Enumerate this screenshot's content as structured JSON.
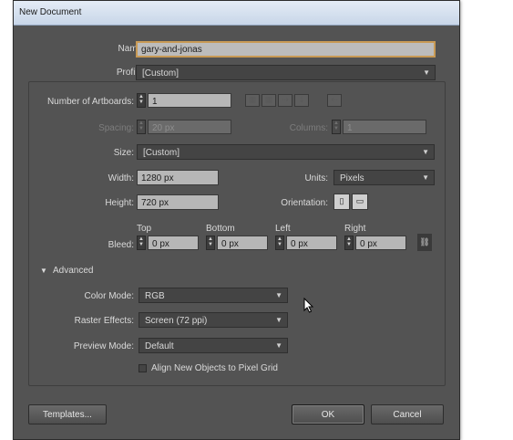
{
  "window": {
    "title": "New Document"
  },
  "name": {
    "label": "Name:",
    "value": "gary-and-jonas"
  },
  "profile": {
    "label": "Profile:",
    "value": "[Custom]"
  },
  "artboards": {
    "label": "Number of Artboards:",
    "value": "1",
    "arrange_icons": [
      "grid-by-row-icon",
      "grid-by-column-icon",
      "arrange-by-row-icon",
      "arrange-by-column-icon",
      "right-to-left-icon"
    ]
  },
  "spacing": {
    "label": "Spacing:",
    "value": "20 px"
  },
  "columns": {
    "label": "Columns:",
    "value": "1"
  },
  "size": {
    "label": "Size:",
    "value": "[Custom]"
  },
  "width": {
    "label": "Width:",
    "value": "1280 px"
  },
  "units": {
    "label": "Units:",
    "value": "Pixels"
  },
  "height": {
    "label": "Height:",
    "value": "720 px"
  },
  "orientation": {
    "label": "Orientation:",
    "options": [
      "portrait-icon",
      "landscape-icon"
    ]
  },
  "bleed": {
    "label": "Bleed:",
    "top": {
      "label": "Top",
      "value": "0 px"
    },
    "bottom": {
      "label": "Bottom",
      "value": "0 px"
    },
    "left": {
      "label": "Left",
      "value": "0 px"
    },
    "right": {
      "label": "Right",
      "value": "0 px"
    },
    "link_icon": "chain-link-icon"
  },
  "advanced": {
    "label": "Advanced",
    "expanded": true,
    "color_mode": {
      "label": "Color Mode:",
      "value": "RGB"
    },
    "raster_effects": {
      "label": "Raster Effects:",
      "value": "Screen (72 ppi)"
    },
    "preview_mode": {
      "label": "Preview Mode:",
      "value": "Default"
    },
    "align_pixel_grid": {
      "label": "Align New Objects to Pixel Grid",
      "checked": false
    }
  },
  "buttons": {
    "templates": "Templates...",
    "ok": "OK",
    "cancel": "Cancel"
  },
  "colors": {
    "dialog_bg": "#535353",
    "name_field_border": "#c89a55",
    "title_bar": "#d6e1ef"
  }
}
